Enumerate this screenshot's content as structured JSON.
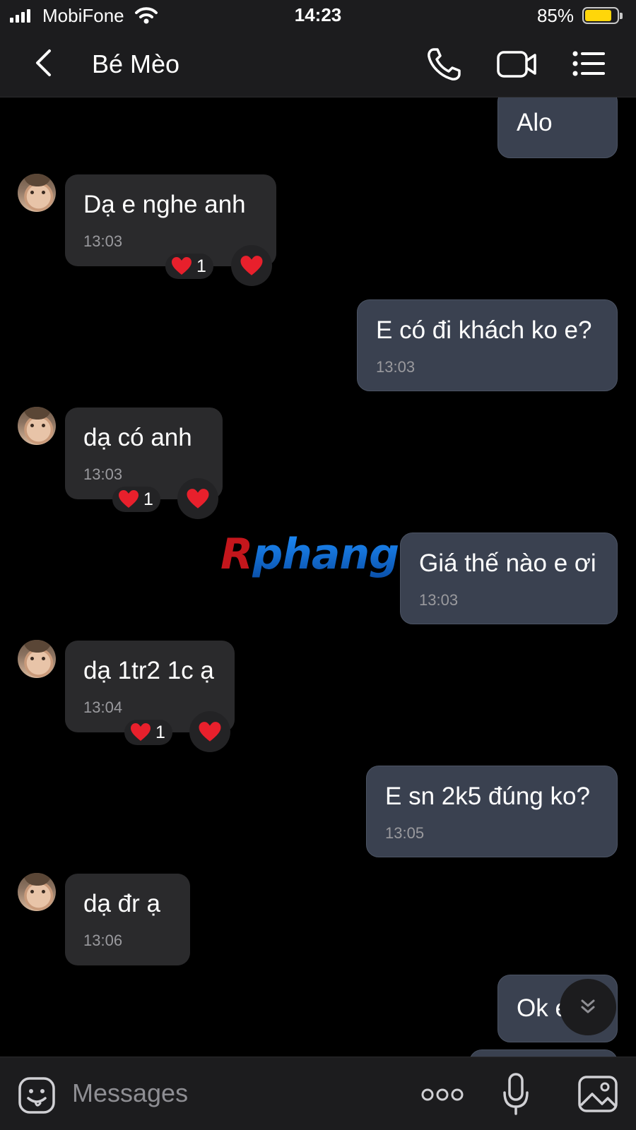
{
  "status_bar": {
    "carrier": "MobiFone",
    "time": "14:23",
    "battery_percent": "85%",
    "battery_level": 0.85
  },
  "header": {
    "contact_name": "Bé Mèo",
    "icons": [
      "back-chevron-icon",
      "phone-icon",
      "video-call-icon",
      "list-menu-icon"
    ]
  },
  "watermark": {
    "first": "R",
    "rest": "phang"
  },
  "messages": [
    {
      "direction": "out",
      "text": "Alo",
      "time": ""
    },
    {
      "direction": "in",
      "text": "Dạ e nghe anh",
      "time": "13:03",
      "reaction_count": "1"
    },
    {
      "direction": "out",
      "text": "E có đi khách ko e?",
      "time": "13:03"
    },
    {
      "direction": "in",
      "text": "dạ có anh",
      "time": "13:03",
      "reaction_count": "1"
    },
    {
      "direction": "out",
      "text": "Giá thế nào e ơi",
      "time": "13:03"
    },
    {
      "direction": "in",
      "text": "dạ 1tr2 1c ạ",
      "time": "13:04",
      "reaction_count": "1"
    },
    {
      "direction": "out",
      "text": "E sn 2k5 đúng ko?",
      "time": "13:05"
    },
    {
      "direction": "in",
      "text": "dạ đr ạ",
      "time": "13:06"
    },
    {
      "direction": "out",
      "text": "Ok e",
      "time": ""
    }
  ],
  "composer": {
    "placeholder": "Messages",
    "icons": [
      "sticker-icon",
      "more-dots-icon",
      "microphone-icon",
      "image-icon"
    ]
  },
  "colors": {
    "background": "#000000",
    "bar_background": "#1c1c1e",
    "incoming_bubble": "#2a2a2c",
    "outgoing_bubble": "#3a4150",
    "heart": "#e8202c",
    "battery": "#ffd60a"
  }
}
